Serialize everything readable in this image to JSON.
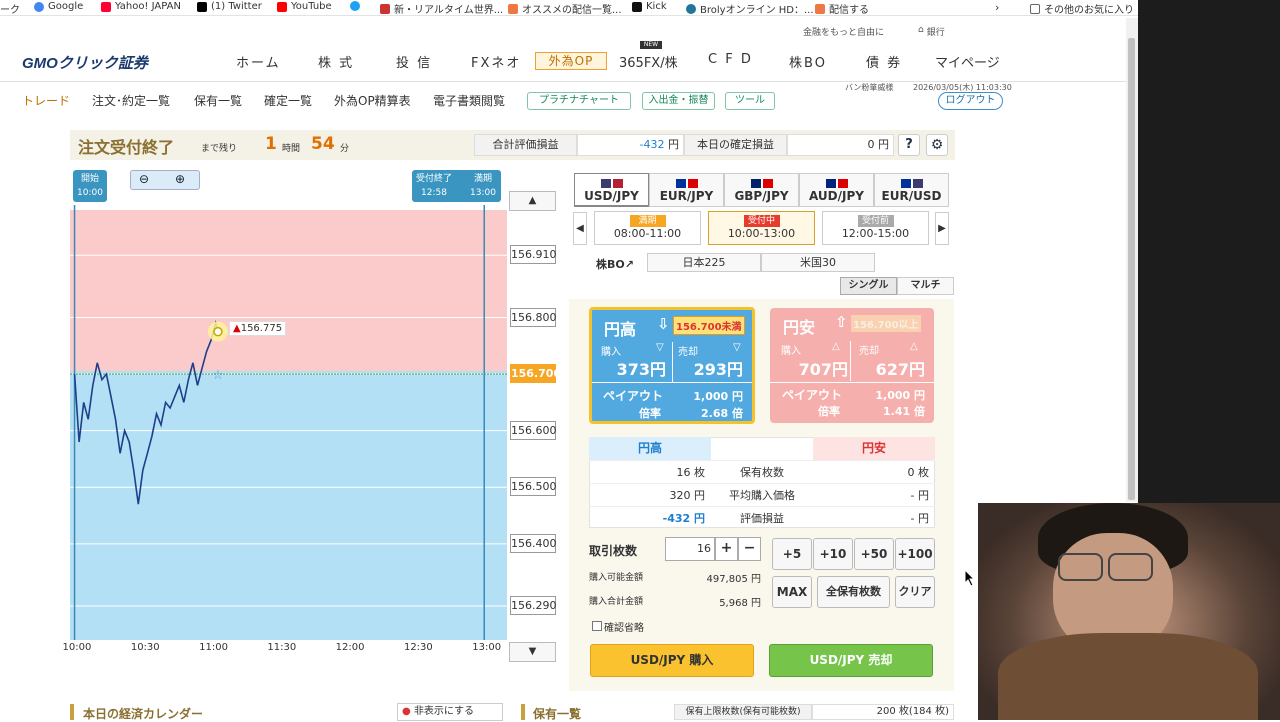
{
  "bookmarks": [
    {
      "label": "ーク",
      "color": "#888"
    },
    {
      "label": "Google",
      "color": "#4285f4"
    },
    {
      "label": "Yahoo! JAPAN",
      "color": "#ff0033"
    },
    {
      "label": "(1) Twitter",
      "color": "#000"
    },
    {
      "label": "YouTube",
      "color": "#ff0000"
    },
    {
      "label": "",
      "color": "#1da1f2"
    },
    {
      "label": "新・リアルタイム世界...",
      "color": "#c33"
    },
    {
      "label": "オススメの配信一覧...",
      "color": "#e74"
    },
    {
      "label": "Kick",
      "color": "#111"
    },
    {
      "label": "Brolyオンライン HD：...",
      "color": "#21759b"
    },
    {
      "label": "配信する",
      "color": "#e74"
    }
  ],
  "bookmarks_other": "その他のお気に入り",
  "top_slogan": "金融をもっと自由に",
  "bank_link": "銀行",
  "logo": "GMOクリック証券",
  "nav": [
    "ホーム",
    "株 式",
    "投 信",
    "FXネオ",
    "外為OP",
    "365FX/株",
    "C F D",
    "株BO",
    "債 券",
    "マイページ"
  ],
  "nav_new_badge": "NEW",
  "subnav": [
    "トレード",
    "注文･約定一覧",
    "保有一覧",
    "確定一覧",
    "外為OP精算表",
    "電子書類閲覧"
  ],
  "pill_buttons": [
    "プラチナチャート",
    "入出金・振替",
    "ツール"
  ],
  "user_name": "バン粉箪威様",
  "datetime": "2026/03/05(木) 11:03:30",
  "logout": "ログアウト",
  "status": {
    "title": "注文受付終了",
    "remaining_label": "まで残り",
    "hours": "1",
    "hours_unit": "時間",
    "minutes": "54",
    "minutes_unit": "分"
  },
  "pnl": {
    "eval_label": "合計評価損益",
    "eval_value": "-432",
    "unit": "円",
    "confirmed_label": "本日の確定損益",
    "confirmed_value": "0"
  },
  "help_icon": "?",
  "chart": {
    "start_label": "開始",
    "start_time": "10:00",
    "end_label": "受付終了",
    "end_time": "12:58",
    "expiry_label": "満期",
    "expiry_time": "13:00",
    "marker_price": "156.775",
    "target_price": "156.700",
    "x_labels": [
      "10:00",
      "10:30",
      "11:00",
      "11:30",
      "12:00",
      "12:30",
      "13:00"
    ],
    "y_labels": [
      "156.910",
      "156.800",
      "156.700",
      "156.600",
      "156.500",
      "156.400",
      "156.290"
    ]
  },
  "chart_data": {
    "type": "line",
    "x": [
      "10:00",
      "10:02",
      "10:04",
      "10:06",
      "10:08",
      "10:10",
      "10:12",
      "10:14",
      "10:16",
      "10:18",
      "10:20",
      "10:22",
      "10:24",
      "10:26",
      "10:28",
      "10:30",
      "10:32",
      "10:34",
      "10:36",
      "10:38",
      "10:40",
      "10:42",
      "10:44",
      "10:46",
      "10:48",
      "10:50",
      "10:52",
      "10:54",
      "10:56",
      "10:58",
      "11:00",
      "11:02",
      "11:03"
    ],
    "values": [
      156.7,
      156.58,
      156.65,
      156.62,
      156.68,
      156.72,
      156.69,
      156.7,
      156.66,
      156.62,
      156.56,
      156.6,
      156.58,
      156.53,
      156.47,
      156.53,
      156.56,
      156.59,
      156.63,
      156.61,
      156.65,
      156.64,
      156.66,
      156.68,
      156.65,
      156.69,
      156.72,
      156.68,
      156.71,
      156.74,
      156.76,
      156.79,
      156.775
    ],
    "target": 156.7,
    "ylim": [
      156.23,
      156.99
    ],
    "x_range": [
      "09:58",
      "13:10"
    ]
  },
  "currencies": [
    "USD/JPY",
    "EUR/JPY",
    "GBP/JPY",
    "AUD/JPY",
    "EUR/USD"
  ],
  "sessions": [
    {
      "status": "満期",
      "time": "08:00-11:00"
    },
    {
      "status": "受付中",
      "time": "10:00-13:00"
    },
    {
      "status": "受付前",
      "time": "12:00-15:00"
    }
  ],
  "kabu_bo": "株BO",
  "kabu_tabs": [
    "日本225",
    "米国30"
  ],
  "mode_tabs": [
    "シングル",
    "マルチ"
  ],
  "high_panel": {
    "title": "円高",
    "condition": "156.700未満",
    "buy_label": "購入",
    "sell_label": "売却",
    "buy_price": "373円",
    "sell_price": "293円",
    "payout_label": "ペイアウト",
    "payout": "1,000 円",
    "rate_label": "倍率",
    "rate": "2.68 倍"
  },
  "low_panel": {
    "title": "円安",
    "condition": "156.700以上",
    "buy_label": "購入",
    "sell_label": "売却",
    "buy_price": "707円",
    "sell_price": "627円",
    "payout_label": "ペイアウト",
    "payout": "1,000 円",
    "rate_label": "倍率",
    "rate": "1.41 倍"
  },
  "holdings": {
    "high_header": "円高",
    "low_header": "円安",
    "rows": [
      {
        "label": "保有枚数",
        "high": "16 枚",
        "low": "0 枚"
      },
      {
        "label": "平均購入価格",
        "high": "320 円",
        "low": "- 円"
      },
      {
        "label": "評価損益",
        "high": "-432 円",
        "low": "- 円"
      }
    ]
  },
  "order": {
    "qty_label": "取引枚数",
    "qty_value": "16",
    "available_label": "購入可能金額",
    "available_value": "497,805 円",
    "total_label": "購入合計金額",
    "total_value": "5,968 円",
    "quick": [
      "+5",
      "+10",
      "+50",
      "+100"
    ],
    "max": "MAX",
    "all": "全保有枚数",
    "clear": "クリア",
    "confirm_skip": "確認省略",
    "buy_button": "USD/JPY 購入",
    "sell_button": "USD/JPY 売却"
  },
  "bottom": {
    "calendar": "本日の経済カレンダー",
    "hide": "非表示にする",
    "holdings": "保有一覧",
    "limit_label": "保有上限枚数(保有可能枚数)",
    "limit_value": "200 枚(184 枚)"
  }
}
